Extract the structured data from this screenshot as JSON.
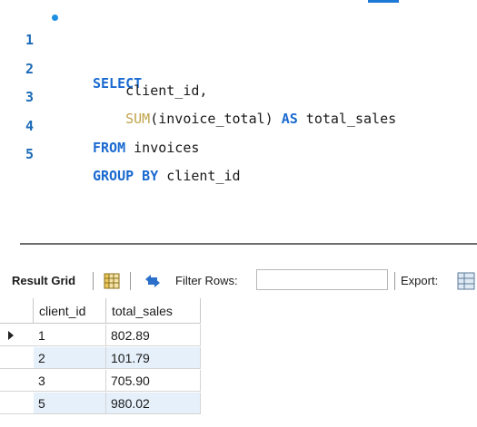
{
  "editor": {
    "lines": [
      {
        "number": "1",
        "parts": [
          {
            "text": "SELECT",
            "kind": "kw"
          }
        ]
      },
      {
        "number": "2",
        "parts": [
          {
            "text": "    client_id,",
            "kind": "id"
          }
        ]
      },
      {
        "number": "3",
        "parts": [
          {
            "text": "    SUM",
            "kind": "fn"
          },
          {
            "text": "(invoice_total) ",
            "kind": "id"
          },
          {
            "text": "AS",
            "kind": "kw"
          },
          {
            "text": " total_sales",
            "kind": "id"
          }
        ]
      },
      {
        "number": "4",
        "parts": [
          {
            "text": "FROM",
            "kind": "kw"
          },
          {
            "text": " invoices",
            "kind": "id"
          }
        ]
      },
      {
        "number": "5",
        "parts": [
          {
            "text": "GROUP BY",
            "kind": "kw"
          },
          {
            "text": " client_id",
            "kind": "id"
          }
        ]
      }
    ]
  },
  "toolbar": {
    "result_grid_label": "Result Grid",
    "filter_label": "Filter Rows:",
    "filter_value": "",
    "export_label": "Export:"
  },
  "grid": {
    "columns": [
      "client_id",
      "total_sales"
    ],
    "rows": [
      [
        "1",
        "802.89"
      ],
      [
        "2",
        "101.79"
      ],
      [
        "3",
        "705.90"
      ],
      [
        "5",
        "980.02"
      ]
    ],
    "selected_row": 0
  },
  "colors": {
    "keyword": "#1a6ad0",
    "function": "#c0a34a",
    "line_number": "#1a6ab8",
    "row_alt": "#e6f0fb"
  }
}
